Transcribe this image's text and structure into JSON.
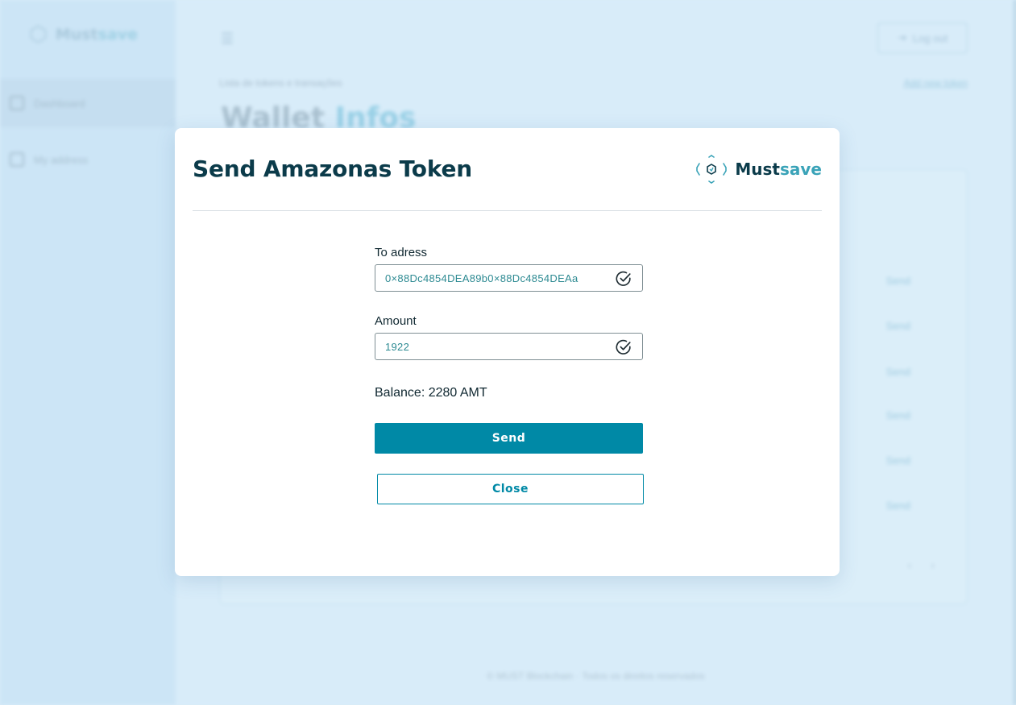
{
  "background": {
    "sidebar": {
      "logo_left": "Must",
      "logo_right": "save",
      "items": [
        {
          "label": "Dashboard",
          "icon": "grid-icon"
        },
        {
          "label": "My address",
          "icon": "pencil-icon"
        }
      ]
    },
    "header": {
      "logout_label": "Log out",
      "subtitle": "Lista de tokens e transações",
      "add_token_label": "Add new token",
      "title_main": "Wallet",
      "title_accent": "Infos"
    },
    "table": {
      "row_actions": [
        "Send",
        "Send",
        "Send",
        "Send",
        "Send",
        "Send"
      ]
    },
    "footer": "© MUST Blockchain · Todos os direitos reservados"
  },
  "modal": {
    "title": "Send Amazonas Token",
    "logo": {
      "must": "Must",
      "save": "save"
    },
    "to_address_label": "To adress",
    "to_address_value": "0×88Dc4854DEA89b0×88Dc4854DEAa",
    "amount_label": "Amount",
    "amount_value": "1922",
    "balance_text": "Balance: 2280 AMT",
    "send_label": "Send",
    "close_label": "Close"
  },
  "colors": {
    "primary": "#0089a6",
    "title": "#0b3b4a",
    "accent": "#3aa3b8",
    "overlay": "#d7ebf8"
  }
}
